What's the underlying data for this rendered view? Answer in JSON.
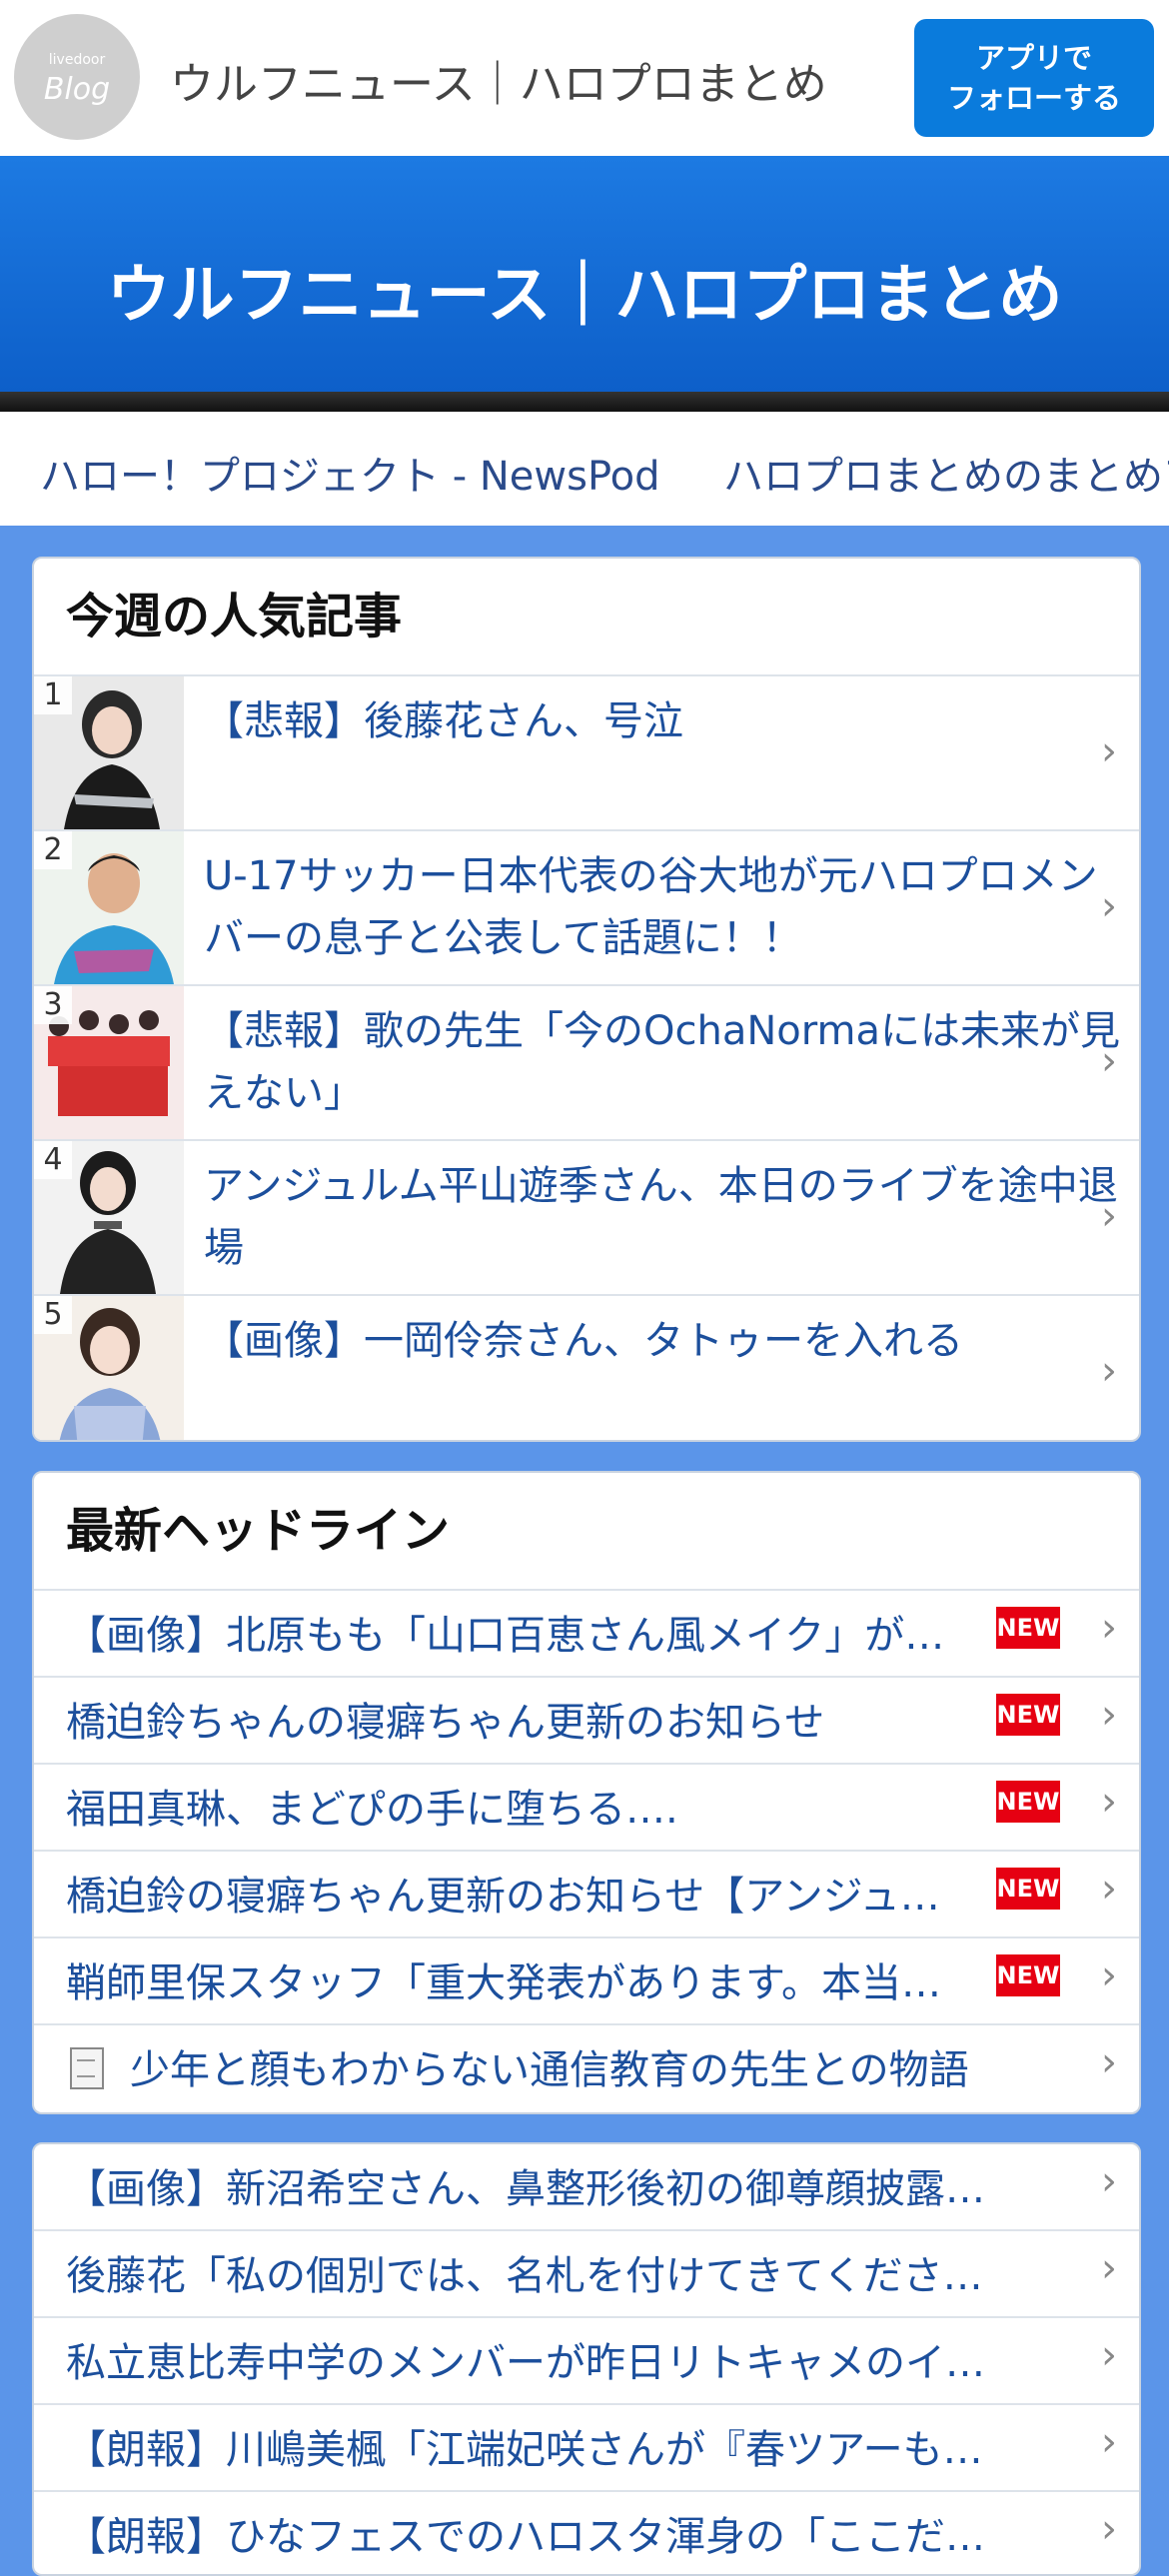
{
  "header": {
    "logo_small": "livedoor",
    "logo_big": "Blog",
    "site_name": "ウルフニュース｜ハロプロまとめ",
    "follow_button": "アプリで\nフォローする"
  },
  "banner": {
    "title": "ウルフニュース｜ハロプロまとめ"
  },
  "linkbar": {
    "items": [
      "ハロー！プロジェクト - NewsPod",
      "ハロプロまとめのまとめア"
    ]
  },
  "popular": {
    "heading": "今週の人気記事",
    "items": [
      {
        "rank": "1",
        "title": "【悲報】後藤花さん、号泣"
      },
      {
        "rank": "2",
        "title": "U-17サッカー日本代表の谷大地が元ハロプロメンバーの息子と公表して話題に！！"
      },
      {
        "rank": "3",
        "title": "【悲報】歌の先生「今のOchaNormaには未来が見えない」"
      },
      {
        "rank": "4",
        "title": "アンジュルム平山遊季さん、本日のライブを途中退場"
      },
      {
        "rank": "5",
        "title": "【画像】一岡伶奈さん、タトゥーを入れる"
      }
    ]
  },
  "headlines": {
    "heading": "最新ヘッドライン",
    "new_badge": "NEW",
    "items": [
      {
        "title": "【画像】北原もも「山口百恵さん風メイク」が…"
      },
      {
        "title": "橋迫鈴ちゃんの寝癖ちゃん更新のお知らせ"
      },
      {
        "title": "福田真琳、まどぴの手に堕ちる…."
      },
      {
        "title": "橋迫鈴の寝癖ちゃん更新のお知らせ【アンジュ…"
      },
      {
        "title": "鞘師里保スタッフ「重大発表があります。本当…"
      },
      {
        "title": "少年と顔もわからない通信教育の先生との物語"
      }
    ]
  },
  "more_headlines": {
    "items": [
      {
        "title": "【画像】新沼希空さん、鼻整形後初の御尊顔披露…"
      },
      {
        "title": "後藤花「私の個別では、名札を付けてきてくださ…"
      },
      {
        "title": "私立恵比寿中学のメンバーが昨日リトキャメのイ…"
      },
      {
        "title": "【朗報】川嶋美楓「江端妃咲さんが『春ツアーも…"
      },
      {
        "title": "【朗報】ひなフェスでのハロスタ渾身の「ここだ…"
      }
    ]
  }
}
